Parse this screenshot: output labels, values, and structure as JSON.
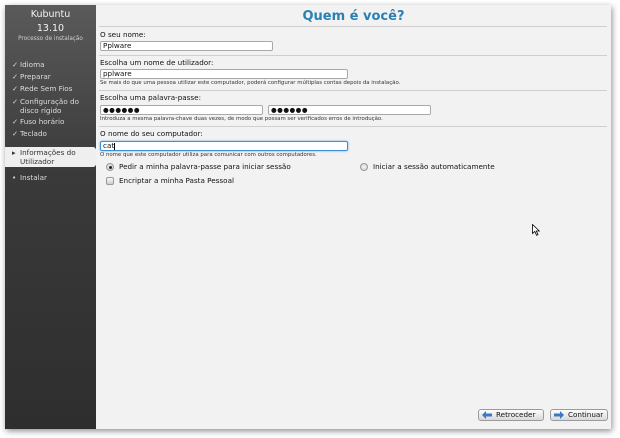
{
  "sidebar": {
    "brand": "Kubuntu",
    "version": "13.10",
    "subtitle": "Processo de instalação",
    "steps": [
      {
        "mark": "✓",
        "label": "Idioma"
      },
      {
        "mark": "✓",
        "label": "Preparar"
      },
      {
        "mark": "✓",
        "label": "Rede Sem Fios"
      },
      {
        "mark": "✓",
        "label": "Configuração do disco rígido"
      },
      {
        "mark": "✓",
        "label": "Fuso horário"
      },
      {
        "mark": "✓",
        "label": "Teclado"
      },
      {
        "mark": "▸",
        "label": "Informações do Utilizador"
      },
      {
        "mark": "•",
        "label": "Instalar"
      }
    ]
  },
  "page": {
    "title": "Quem é você?"
  },
  "form": {
    "name": {
      "label": "O seu nome:",
      "value": "Pplware"
    },
    "username": {
      "label": "Escolha um nome de utilizador:",
      "value": "pplware",
      "hint": "Se mais do que uma pessoa utilizar este computador, poderá configurar múltiplas contas depois da instalação."
    },
    "password": {
      "label": "Escolha uma palavra-passe:",
      "value1": "●●●●●●",
      "value2": "●●●●●●",
      "hint": "Introduza a mesma palavra-chave duas vezes, de modo que possam ser verificados erros de introdução."
    },
    "hostname": {
      "label": "O nome do seu computador:",
      "value": "cat",
      "hint": "O nome que este computador utiliza para comunicar com outros computadores."
    },
    "login_password": {
      "label": "Pedir a minha palavra-passe para iniciar sessão",
      "selected": true
    },
    "login_auto": {
      "label": "Iniciar a sessão automaticamente",
      "selected": false
    },
    "encrypt": {
      "label": "Encriptar a minha Pasta Pessoal",
      "checked": false
    }
  },
  "buttons": {
    "back": "Retroceder",
    "next": "Continuar"
  },
  "colors": {
    "title": "#2a7fb5",
    "focus": "#3b8fd9",
    "sidebar": "#3a3a3a"
  }
}
